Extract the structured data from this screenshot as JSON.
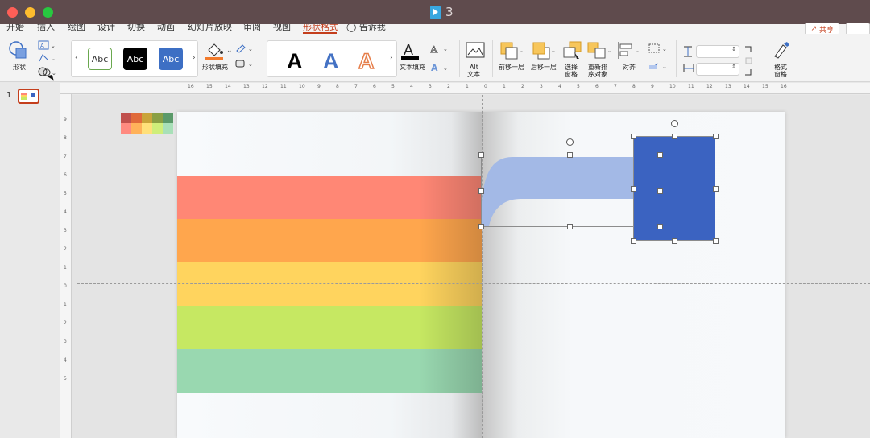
{
  "window": {
    "title": "3"
  },
  "tabs": [
    {
      "label": "开始"
    },
    {
      "label": "插入"
    },
    {
      "label": "绘图"
    },
    {
      "label": "设计"
    },
    {
      "label": "切换"
    },
    {
      "label": "动画"
    },
    {
      "label": "幻灯片放映"
    },
    {
      "label": "审阅"
    },
    {
      "label": "视图"
    },
    {
      "label": "形状格式"
    },
    {
      "label": "告诉我"
    }
  ],
  "header": {
    "share_label": "共享"
  },
  "ribbon": {
    "shape_label": "形状",
    "styles": [
      {
        "text": "Abc",
        "bg": "#ffffff",
        "fg": "#333333",
        "border": "#6aa84f"
      },
      {
        "text": "Abc",
        "bg": "#000000",
        "fg": "#ffffff",
        "border": "#000000"
      },
      {
        "text": "Abc",
        "bg": "#3d6fc4",
        "fg": "#ffffff",
        "border": "#3d6fc4"
      }
    ],
    "shape_fill_label": "形状填充",
    "text_fill_label": "文本填充",
    "alt_text_line1": "Alt",
    "alt_text_line2": "文本",
    "bring_forward_label": "前移一层",
    "send_backward_label": "后移一层",
    "selection_pane_line1": "选择",
    "selection_pane_line2": "窗格",
    "reorder_line1": "重新排",
    "reorder_line2": "序对象",
    "align_label": "对齐",
    "format_pane_line1": "格式",
    "format_pane_line2": "窗格",
    "height_value": "",
    "width_value": ""
  },
  "thumbnails": [
    {
      "number": "1"
    }
  ],
  "rulers": {
    "h_ticks": [
      "16",
      "15",
      "14",
      "13",
      "12",
      "11",
      "10",
      "9",
      "8",
      "7",
      "6",
      "5",
      "4",
      "3",
      "2",
      "1",
      "0",
      "1",
      "2",
      "3",
      "4",
      "5",
      "6",
      "7",
      "8",
      "9",
      "10",
      "11",
      "12",
      "13",
      "14",
      "15",
      "16"
    ],
    "v_ticks": [
      "9",
      "8",
      "7",
      "6",
      "5",
      "4",
      "3",
      "2",
      "1",
      "0",
      "1",
      "2",
      "3",
      "4",
      "5"
    ]
  },
  "slide": {
    "bands": [
      {
        "color": "#ff8775"
      },
      {
        "color": "#ffa64d"
      },
      {
        "color": "#ffd45e"
      },
      {
        "color": "#c6e862"
      },
      {
        "color": "#99d8b0"
      }
    ],
    "palette": [
      "#c0504d",
      "#e06a3a",
      "#c9a43a",
      "#8aa044",
      "#5b9a6a",
      "#ff8a80",
      "#ffb25a",
      "#ffe07a",
      "#cfee7a",
      "#a8e0b8"
    ],
    "curve_color": "#a3b9e6",
    "box_color": "#3b63c1"
  }
}
